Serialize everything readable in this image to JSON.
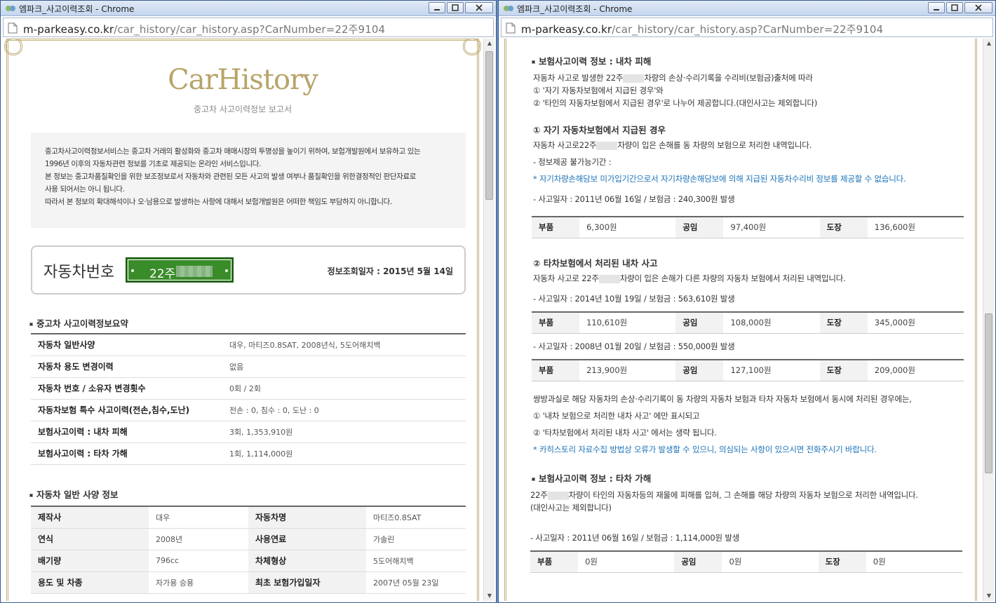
{
  "window_title": "엠파크_사고이력조회 - Chrome",
  "url_host": "m-parkeasy.co.kr",
  "url_path": "/car_history/car_history.asp?CarNumber=22주9104",
  "left": {
    "logo": "CarHistory",
    "logo_sub": "중고차 사고이력정보 보고서",
    "intro": [
      "중고차사고이력정보서비스는 중고차 거래의 활성화와 중고차 매매시장의 투명성을 높이기 위하여, 보험개발원에서 보유하고 있는",
      "1996년 이후의 자동차관련 정보를 기초로 제공되는 온라인 서비스입니다.",
      "본 정보는 중고차품질확인을 위한 보조정보로서 자동차와 관련된 모든 사고의 발생 여부나 품질확인을 위한결정적인 판단자료로",
      "사용 되어서는 아니 됩니다.",
      "따라서 본 정보의 확대해석이나 오·남용으로 발생하는 사항에 대해서 보험개발원은 어떠한 책임도 부담하지 아니합니다."
    ],
    "plate_label": "자동차번호",
    "plate_number": "22주",
    "lookup_date": "정보조회일자 : 2015년 5월 14일",
    "summary_title": "중고차 사고이력정보요약",
    "summary": [
      {
        "k": "자동차 일반사양",
        "v": "대우, 마티즈0.8SAT, 2008년식, 5도어해치백"
      },
      {
        "k": "자동차 용도 변경이력",
        "v": "없음"
      },
      {
        "k": "자동차 번호 / 소유자 변경횟수",
        "v": "0회 / 2회"
      },
      {
        "k": "자동차보험 특수 사고이력(전손,침수,도난)",
        "v": "전손 : 0, 침수 : 0, 도난 : 0"
      },
      {
        "k": "보험사고이력 : 내차 피해",
        "v": "3회, 1,353,910원"
      },
      {
        "k": "보험사고이력 : 타차 가해",
        "v": "1회, 1,114,000원"
      }
    ],
    "spec_title": "자동차 일반 사양 정보",
    "spec": [
      {
        "k1": "제작사",
        "v1": "대우",
        "k2": "자동차명",
        "v2": "마티즈0.8SAT"
      },
      {
        "k1": "연식",
        "v1": "2008년",
        "k2": "사용연료",
        "v2": "가솔린"
      },
      {
        "k1": "배기량",
        "v1": "796cc",
        "k2": "차체형상",
        "v2": "5도어해치백"
      },
      {
        "k1": "용도 및 차종",
        "v1": "자가용 승용",
        "k2": "최초 보험가입일자",
        "v2": "2007년 05월 23일"
      }
    ]
  },
  "right": {
    "sec1_title": "보험사고이력 정보 : 내차 피해",
    "sec1_lines": [
      "자동차 사고로 발생한 22주",
      "차량의 손상·수리기록을 수리비(보험금)출처에 따라",
      "① '자기 자동차보험에서 지급된 경우'와",
      "② '타인의 자동차보험에서 지급된 경우'로 나누어 제공합니다.(대인사고는 제외합니다)"
    ],
    "sub1_title": "① 자기 자동차보험에서 지급된 경우",
    "sub1_line_a": "자동차 사고로22주",
    "sub1_line_b": "차량이 입은 손해를 동 차량의 보험으로 처리한 내역입니다.",
    "sub1_period": "- 정보제공 불가능기간 :",
    "sub1_note": "* 자기차량손해담보 미가입기간으로서 자기차량손해담보에 의해 지급된 자동차수리비 정보를 제공할 수 없습니다.",
    "sub1_accident": "- 사고일자 : 2011년 06월 16일 / 보험금 : 240,300원 발생",
    "sub1_cost": {
      "parts": "6,300원",
      "labor": "97,400원",
      "paint": "136,600원"
    },
    "cost_labels": {
      "parts": "부품",
      "labor": "공임",
      "paint": "도장"
    },
    "sub2_title": "② 타차보험에서 처리된 내차 사고",
    "sub2_line_a": "자동차 사고로 22주",
    "sub2_line_b": "차량이 입은 손해가 다른 차량의 자동차 보험에서 처리된 내역입니다.",
    "sub2_acc1": "- 사고일자 : 2014년 10월 19일 / 보험금 : 563,610원 발생",
    "sub2_cost1": {
      "parts": "110,610원",
      "labor": "108,000원",
      "paint": "345,000원"
    },
    "sub2_acc2": "- 사고일자 : 2008년 01월 20일 / 보험금 : 550,000원 발생",
    "sub2_cost2": {
      "parts": "213,900원",
      "labor": "127,100원",
      "paint": "209,000원"
    },
    "both_note1": "쌍방과실로 해당 자동차의 손상·수리기록이 동 차량의 자동차 보험과 타차 자동차 보험에서 동시에 처리된 경우에는,",
    "both_note2": "① '내차 보험으로 처리한 내차 사고' 에만 표시되고",
    "both_note3": "② '타차보험에서 처리된 내차 사고' 에서는 생략 됩니다.",
    "both_note4": "* 카히스토리 자료수집 방법상 오류가 발생할 수 있으니, 의심되는 사항이 있으시면 전화주시기 바랍니다.",
    "sec2_title": "보험사고이력 정보 : 타차 가해",
    "sec2_line_a": "22주",
    "sec2_line_b": "차량이 타인의 자동차등의 재물에 피해를 입혀, 그 손해를 해당 차량의 자동차 보험으로 처리한 내역입니다.",
    "sec2_line2": "(대인사고는 제외합니다)",
    "sec2_accident": "- 사고일자 : 2011년 06월 16일 / 보험금 : 1,114,000원 발생",
    "sec2_cost": {
      "parts": "0원",
      "labor": "0원",
      "paint": "0원"
    }
  }
}
